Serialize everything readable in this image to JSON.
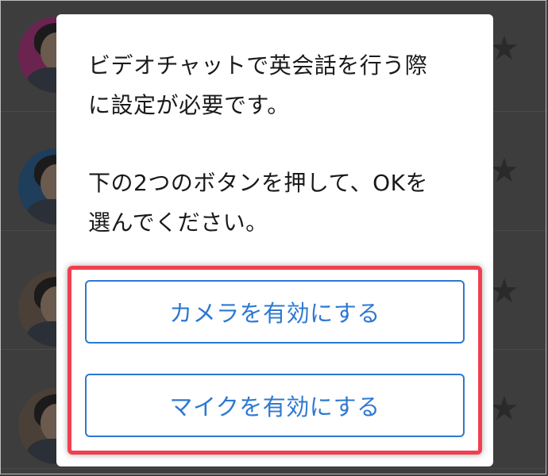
{
  "dialog": {
    "message_line1": "ビデオチャットで英会話を行う際",
    "message_line2": "に設定が必要です。",
    "message_line3": "下の2つのボタンを押して、OKを",
    "message_line4": "選んでください。"
  },
  "buttons": {
    "enable_camera": "カメラを有効にする",
    "enable_mic": "マイクを有効にする"
  },
  "background_list": {
    "items": [
      {
        "avatar_ring": "#b32a7a",
        "star_icon": "star-icon"
      },
      {
        "avatar_ring": "#2c5f8a",
        "star_icon": "star-icon"
      },
      {
        "avatar_ring": "#7a6a5a",
        "star_icon": "star-icon"
      },
      {
        "avatar_ring": "#7a6a5a",
        "star_icon": "star-icon"
      }
    ]
  },
  "colors": {
    "accent": "#2d78d2",
    "highlight": "#f0404f",
    "overlay": "#3d3d3d"
  }
}
